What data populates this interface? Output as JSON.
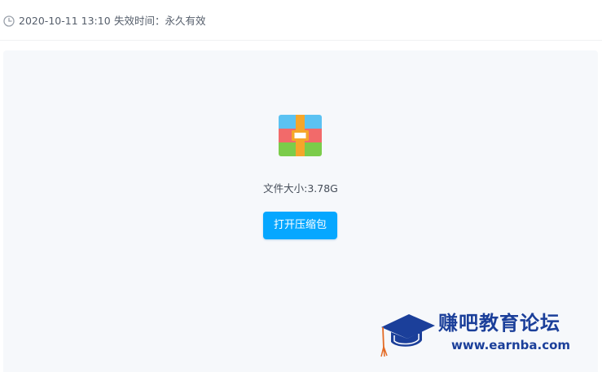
{
  "meta": {
    "clock_icon": "clock-icon",
    "date": "2020-10-11 13:10",
    "expiry": "失效时间：永久有效"
  },
  "file": {
    "icon": "zip-archive-icon",
    "size_text": "文件大小:3.78G",
    "open_button_label": "打开压缩包"
  },
  "watermark": {
    "icon": "mortarboard-icon",
    "name": "赚吧教育论坛",
    "url": "www.earnba.com"
  },
  "colors": {
    "accent": "#06a7ff",
    "panel_bg": "#f6f8fb",
    "watermark_blue": "#1b3f9a"
  }
}
